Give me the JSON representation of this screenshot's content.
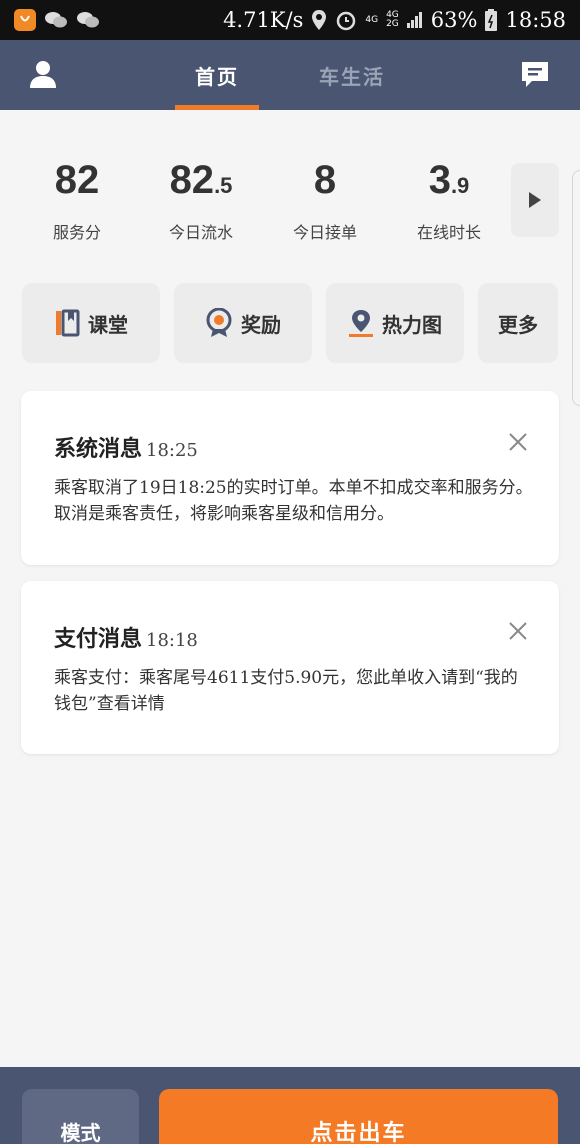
{
  "status_bar": {
    "speed": "4.71K/s",
    "net_top": "4G",
    "net_bottom": "2G",
    "net_mid": "4G",
    "battery": "63%",
    "time": "18:58"
  },
  "header": {
    "tabs": [
      {
        "label": "首页",
        "active": true
      },
      {
        "label": "车生活",
        "active": false
      }
    ]
  },
  "stats": [
    {
      "int": "82",
      "dec": "",
      "label": "服务分"
    },
    {
      "int": "82",
      "dec": ".5",
      "label": "今日流水"
    },
    {
      "int": "8",
      "dec": "",
      "label": "今日接单"
    },
    {
      "int": "3",
      "dec": ".9",
      "label": "在线时长"
    }
  ],
  "quick_entries": [
    {
      "label": "课堂",
      "icon": "book-icon"
    },
    {
      "label": "奖励",
      "icon": "medal-icon"
    },
    {
      "label": "热力图",
      "icon": "location-pin-icon"
    },
    {
      "label": "更多",
      "icon": ""
    }
  ],
  "messages": [
    {
      "title": "系统消息",
      "time": "18:25",
      "body": "乘客取消了19日18:25的实时订单。本单不扣成交率和服务分。取消是乘客责任，将影响乘客星级和信用分。"
    },
    {
      "title": "支付消息",
      "time": "18:18",
      "body": "乘客支付：乘客尾号4611支付5.90元，您此单收入请到“我的钱包”查看详情"
    }
  ],
  "bottom": {
    "mode_label": "模式",
    "go_label": "点击出车"
  },
  "colors": {
    "header_bg": "#4a5571",
    "accent": "#f47a26",
    "page_bg": "#f5f5f5"
  }
}
